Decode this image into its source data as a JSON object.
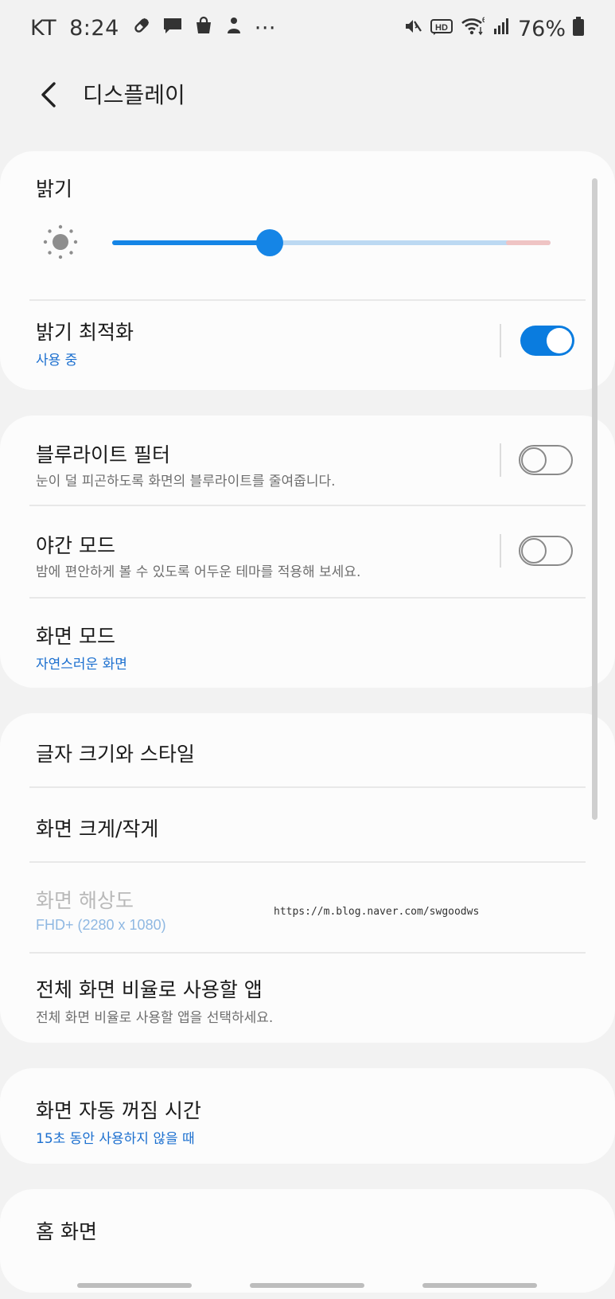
{
  "status_bar": {
    "carrier": "KT",
    "time": "8:24",
    "more": "···",
    "battery": "76%",
    "hd_label": "HD",
    "wifi_superscript": "6",
    "left_icons": [
      "pill-icon",
      "message-icon",
      "shopping-bag-icon",
      "person-icon"
    ],
    "right_icons": [
      "mute-icon",
      "hd-voice-icon",
      "wifi-icon",
      "signal-icon",
      "battery-icon"
    ]
  },
  "header": {
    "back_icon": "back-chevron-icon",
    "title": "디스플레이"
  },
  "brightness": {
    "title": "밝기",
    "icon": "sun-icon",
    "level": 0.36,
    "adaptive": {
      "title": "밝기 최적화",
      "subtitle": "사용 중",
      "enabled": true
    }
  },
  "filters": {
    "blue_light": {
      "title": "블루라이트 필터",
      "subtitle": "눈이 덜 피곤하도록 화면의 블루라이트를 줄여줍니다.",
      "enabled": false
    },
    "dark_mode": {
      "title": "야간 모드",
      "subtitle": "밤에 편안하게 볼 수 있도록 어두운 테마를 적용해 보세요.",
      "enabled": false
    },
    "screen_mode": {
      "title": "화면 모드",
      "subtitle": "자연스러운 화면"
    }
  },
  "text_display": {
    "font_style": {
      "title": "글자 크기와 스타일"
    },
    "zoom": {
      "title": "화면 크게/작게"
    },
    "resolution": {
      "title": "화면 해상도",
      "subtitle": "FHD+ (2280 x 1080)"
    },
    "full_screen_apps": {
      "title": "전체 화면 비율로 사용할 앱",
      "subtitle": "전체 화면 비율로 사용할 앱을 선택하세요."
    }
  },
  "timeout": {
    "title": "화면 자동 꺼짐 시간",
    "subtitle": "15초 동안 사용하지 않을 때"
  },
  "home": {
    "title": "홈 화면"
  },
  "watermark": "https://m.blog.naver.com/swgoodws",
  "colors": {
    "accent": "#1585e6",
    "toggle_on": "#0a7cdf",
    "subtitle_blue": "#1b6fcf",
    "background": "#f2f2f2",
    "card": "#fcfcfc"
  }
}
